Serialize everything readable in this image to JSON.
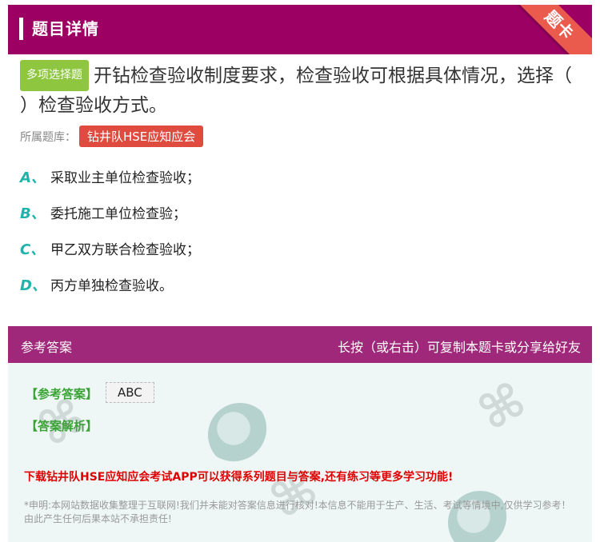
{
  "header": {
    "title": "题目详情",
    "ribbon": "题卡"
  },
  "question": {
    "type_badge": "多项选择题",
    "text": "开钻检查验收制度要求，检查验收可根据具体情况，选择（ ）检查验收方式。",
    "source_label": "所属题库：",
    "library": "钻井队HSE应知应会"
  },
  "options": [
    {
      "letter": "A、",
      "text": "采取业主单位检查验收；"
    },
    {
      "letter": "B、",
      "text": "委托施工单位检查验；"
    },
    {
      "letter": "C、",
      "text": "甲乙双方联合检查验收；"
    },
    {
      "letter": "D、",
      "text": "丙方单独检查验收。"
    }
  ],
  "answer_bar": {
    "left": "参考答案",
    "right": "长按（或右击）可复制本题卡或分享给好友"
  },
  "answer": {
    "ref_label": "【参考答案】",
    "ref_value": "ABC",
    "explain_label": "【答案解析】",
    "promo": "下载钻井队HSE应知应会考试APP可以获得系列题目与答案,还有练习等更多学习功能!",
    "disclaimer": "*申明:本网站数据收集整理于互联网!我们并未能对答案信息进行核对!本信息不能用于生产、生活、考试等情境中,仅供学习参考！由此产生任何后果本站不承担责任!"
  },
  "colors": {
    "header_bg": "#9b0062",
    "ribbon": "#ea5b4e",
    "badge_green": "#8ec63f",
    "library_red": "#e04b3f",
    "option_letter": "#1fb3aa",
    "answer_bar": "#a0287a",
    "answer_bg": "#eef7f6",
    "label_green": "#3aa335",
    "promo_red": "#e00000"
  }
}
